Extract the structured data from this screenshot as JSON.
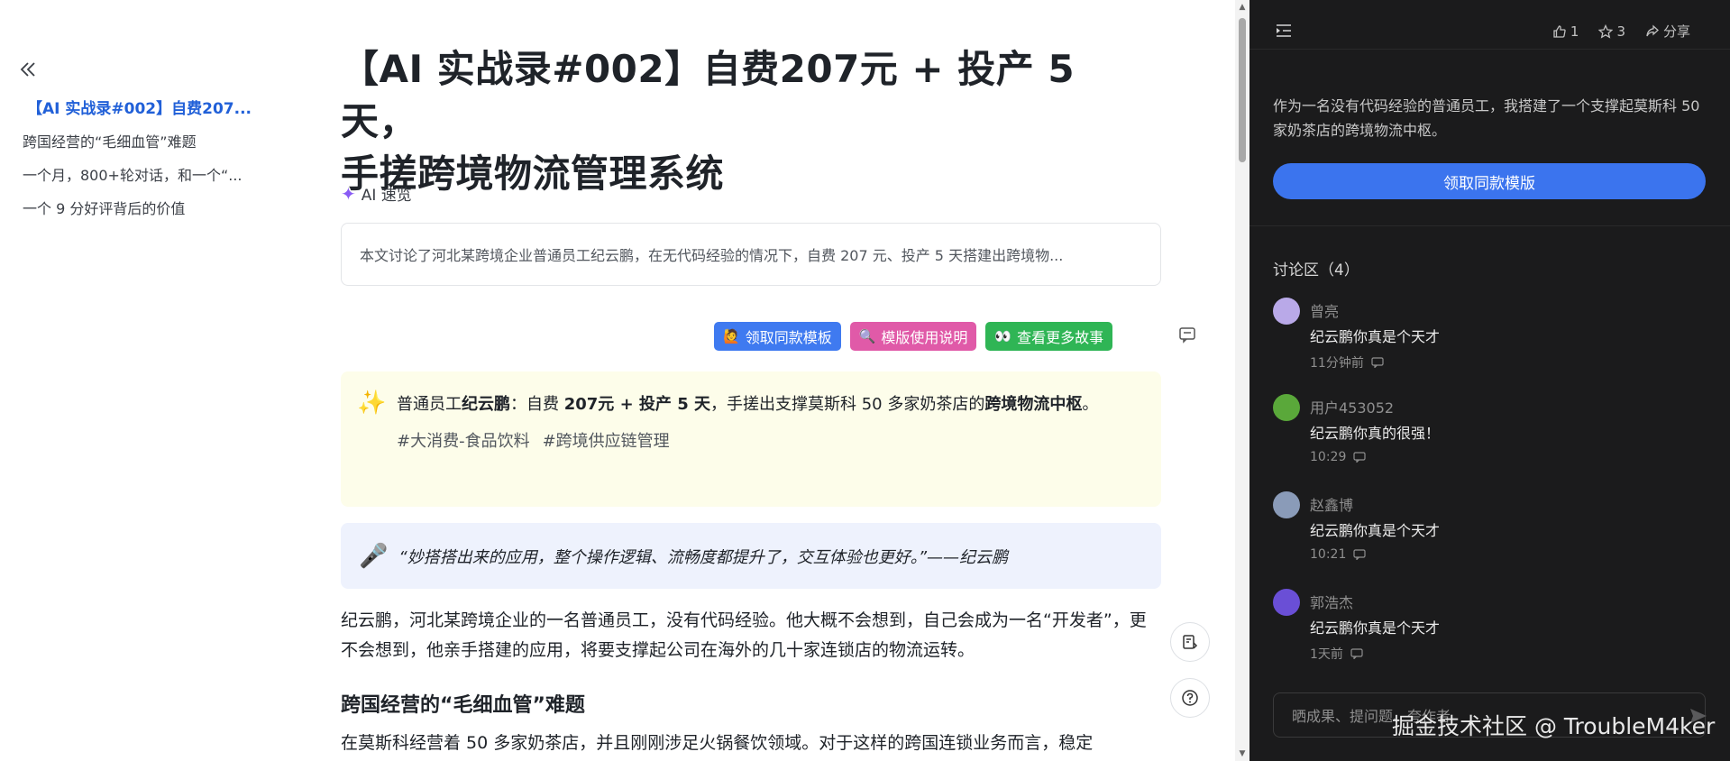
{
  "toc": {
    "items": [
      {
        "label": "【AI 实战录#002】自费207...",
        "active": true
      },
      {
        "label": "跨国经营的“毛细血管”难题",
        "active": false
      },
      {
        "label": "一个月，800+轮对话，和一个“...",
        "active": false
      },
      {
        "label": "一个 9 分好评背后的价值",
        "active": false
      }
    ]
  },
  "article": {
    "title_line1": "【AI 实战录#002】自费207元 + 投产 5 天，",
    "title_line2": "手搓跨境物流管理系统",
    "ai_label": "AI 速览",
    "summary": "本文讨论了河北某跨境企业普通员工纪云鹏，在无代码经验的情况下，自费 207 元、投产 5 天搭建出跨境物...",
    "buttons": {
      "get_template": "领取同款模板",
      "template_guide": "模版使用说明",
      "more_stories": "查看更多故事"
    },
    "highlight": {
      "p1": "普通员工",
      "b1": "纪云鹏",
      "p2": "：自费 ",
      "b2": "207元 + 投产 5 天",
      "p3": "，手搓出支撑莫斯科 50 多家奶茶店的",
      "b3": "跨境物流中枢",
      "p4": "。",
      "tag1": "#大消费-食品饮料",
      "tag2": "#跨境供应链管理"
    },
    "quote": "“妙搭搭出来的应用，整个操作逻辑、流畅度都提升了，交互体验也更好。”——纪云鹏",
    "para1": "纪云鹏，河北某跨境企业的一名普通员工，没有代码经验。他大概不会想到，自己会成为一名“开发者”，更不会想到，他亲手搭建的应用，将要支撑起公司在海外的几十家连锁店的物流运转。",
    "h2": "跨国经营的“毛细血管”难题",
    "para2": "在莫斯科经营着 50 多家奶茶店，并且刚刚涉足火锅餐饮领域。对于这样的跨国连锁业务而言，稳定"
  },
  "panel": {
    "likes": "1",
    "stars": "3",
    "share": "分享",
    "description": "作为一名没有代码经验的普通员工，我搭建了一个支撑起莫斯科 50 家奶茶店的跨境物流中枢。",
    "cta": "领取同款模版",
    "discussion_title": "讨论区（4）",
    "comments": [
      {
        "name": "曾亮",
        "body": "纪云鹏你真是个天才",
        "time": "11分钟前",
        "avatar_color": "#b9a9e8"
      },
      {
        "name": "用户453052",
        "body": "纪云鹏你真的很强！",
        "time": "10:29",
        "avatar_color": "#5aa83a"
      },
      {
        "name": "赵鑫博",
        "body": "纪云鹏你真是个天才",
        "time": "10:21",
        "avatar_color": "#8a9bb8"
      },
      {
        "name": "郭浩杰",
        "body": "纪云鹏你真是个天才",
        "time": "1天前",
        "avatar_color": "#6a4fd6"
      }
    ],
    "input_placeholder": "晒成果、提问题、夸作者",
    "watermark": "掘金技术社区 @ TroubleM4ker"
  }
}
